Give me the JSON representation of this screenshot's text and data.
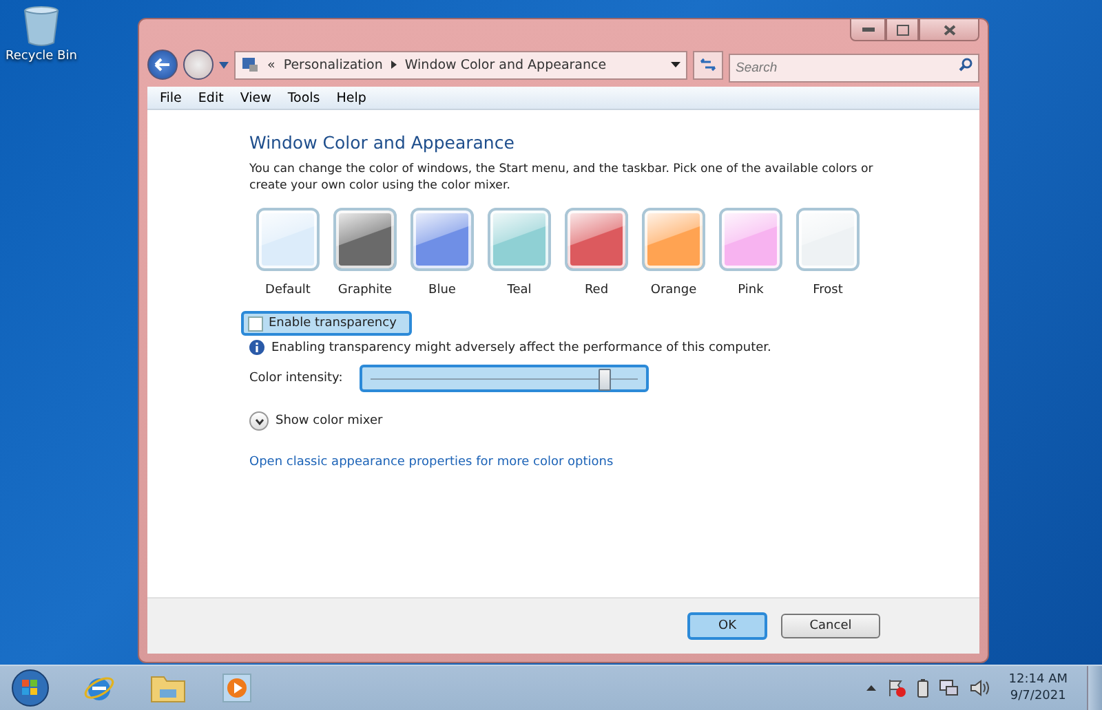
{
  "desktop": {
    "icons": [
      {
        "label": "Recycle Bin"
      }
    ]
  },
  "window": {
    "breadcrumb": {
      "overflow": "«",
      "items": [
        "Personalization",
        "Window Color and Appearance"
      ]
    },
    "search": {
      "placeholder": "Search"
    },
    "menu": [
      "File",
      "Edit",
      "View",
      "Tools",
      "Help"
    ],
    "heading": "Window Color and Appearance",
    "description": "You can change the color of windows, the Start menu, and the taskbar. Pick one of the available colors or create your own color using the color mixer.",
    "swatches": [
      {
        "label": "Default",
        "color": "#dcecfa"
      },
      {
        "label": "Graphite",
        "color": "#6a6a6a"
      },
      {
        "label": "Blue",
        "color": "#6f8fe6"
      },
      {
        "label": "Teal",
        "color": "#8fd0d4"
      },
      {
        "label": "Red",
        "color": "#dc5a5e"
      },
      {
        "label": "Orange",
        "color": "#ffa352"
      },
      {
        "label": "Pink",
        "color": "#f7b3f0"
      },
      {
        "label": "Frost",
        "color": "#eef2f4"
      }
    ],
    "transparency": {
      "label": "Enable transparency",
      "checked": false,
      "highlighted": true
    },
    "info": "Enabling transparency might adversely affect the performance of this computer.",
    "intensity": {
      "label": "Color intensity:",
      "level": 0.88,
      "highlighted": true
    },
    "mixer": {
      "label": "Show color mixer",
      "expanded": false
    },
    "link": "Open classic appearance properties for more color options",
    "buttons": [
      {
        "label": "OK",
        "highlighted": true
      },
      {
        "label": "Cancel",
        "highlighted": false
      }
    ]
  },
  "taskbar": {
    "clock": {
      "time": "12:14 AM",
      "date": "9/7/2021"
    }
  }
}
